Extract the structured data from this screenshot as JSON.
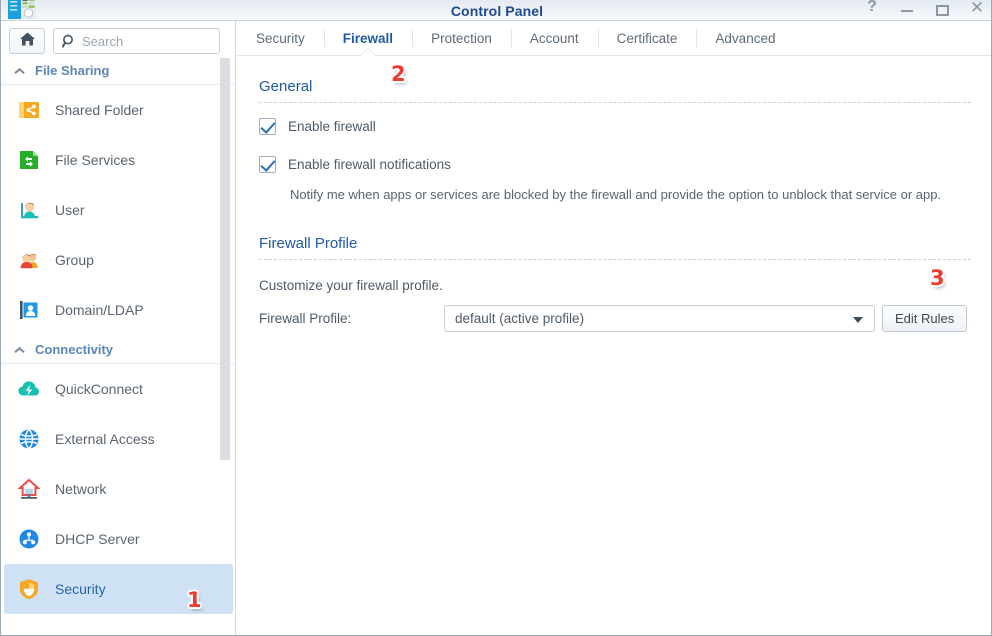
{
  "window": {
    "title": "Control Panel",
    "app_icon": "control-panel-icon",
    "controls": [
      {
        "name": "help-button",
        "glyph": "?"
      },
      {
        "name": "minimize-button",
        "glyph": "–"
      },
      {
        "name": "maximize-button",
        "glyph": "□"
      },
      {
        "name": "close-button",
        "glyph": "✕"
      }
    ]
  },
  "sidebar": {
    "home_icon": "home-icon",
    "search": {
      "placeholder": "Search",
      "value": "",
      "icon": "search-icon"
    },
    "groups": [
      {
        "label": "File Sharing",
        "collapse_icon": "chevron-up-icon",
        "items": [
          {
            "label": "Shared Folder",
            "icon": "shared-folder-icon"
          },
          {
            "label": "File Services",
            "icon": "file-services-icon"
          },
          {
            "label": "User",
            "icon": "user-icon"
          },
          {
            "label": "Group",
            "icon": "group-icon"
          },
          {
            "label": "Domain/LDAP",
            "icon": "domain-ldap-icon"
          }
        ]
      },
      {
        "label": "Connectivity",
        "collapse_icon": "chevron-up-icon",
        "items": [
          {
            "label": "QuickConnect",
            "icon": "quickconnect-icon"
          },
          {
            "label": "External Access",
            "icon": "external-access-icon"
          },
          {
            "label": "Network",
            "icon": "network-icon"
          },
          {
            "label": "DHCP Server",
            "icon": "dhcp-server-icon"
          },
          {
            "label": "Security",
            "icon": "security-shield-icon",
            "selected": true
          }
        ]
      }
    ]
  },
  "tabs": [
    {
      "label": "Security",
      "active": false
    },
    {
      "label": "Firewall",
      "active": true
    },
    {
      "label": "Protection",
      "active": false
    },
    {
      "label": "Account",
      "active": false
    },
    {
      "label": "Certificate",
      "active": false
    },
    {
      "label": "Advanced",
      "active": false
    }
  ],
  "general": {
    "title": "General",
    "enable_firewall": {
      "label": "Enable firewall",
      "checked": true
    },
    "enable_notifications": {
      "label": "Enable firewall notifications",
      "checked": true
    },
    "note": "Notify me when apps or services are blocked by the firewall and provide the option to unblock that service or app."
  },
  "firewall_profile": {
    "title": "Firewall Profile",
    "description": "Customize your firewall profile.",
    "field_label": "Firewall Profile:",
    "selected_profile": "default (active profile)",
    "edit_rules_label": "Edit Rules"
  },
  "markers": {
    "one": "1",
    "two": "2",
    "three": "3"
  },
  "colors": {
    "accent_blue": "#1f5aa8",
    "selection_blue": "#cfe2f5",
    "marker_red": "#ef3b2d",
    "title_blue": "#1e4b8f"
  }
}
